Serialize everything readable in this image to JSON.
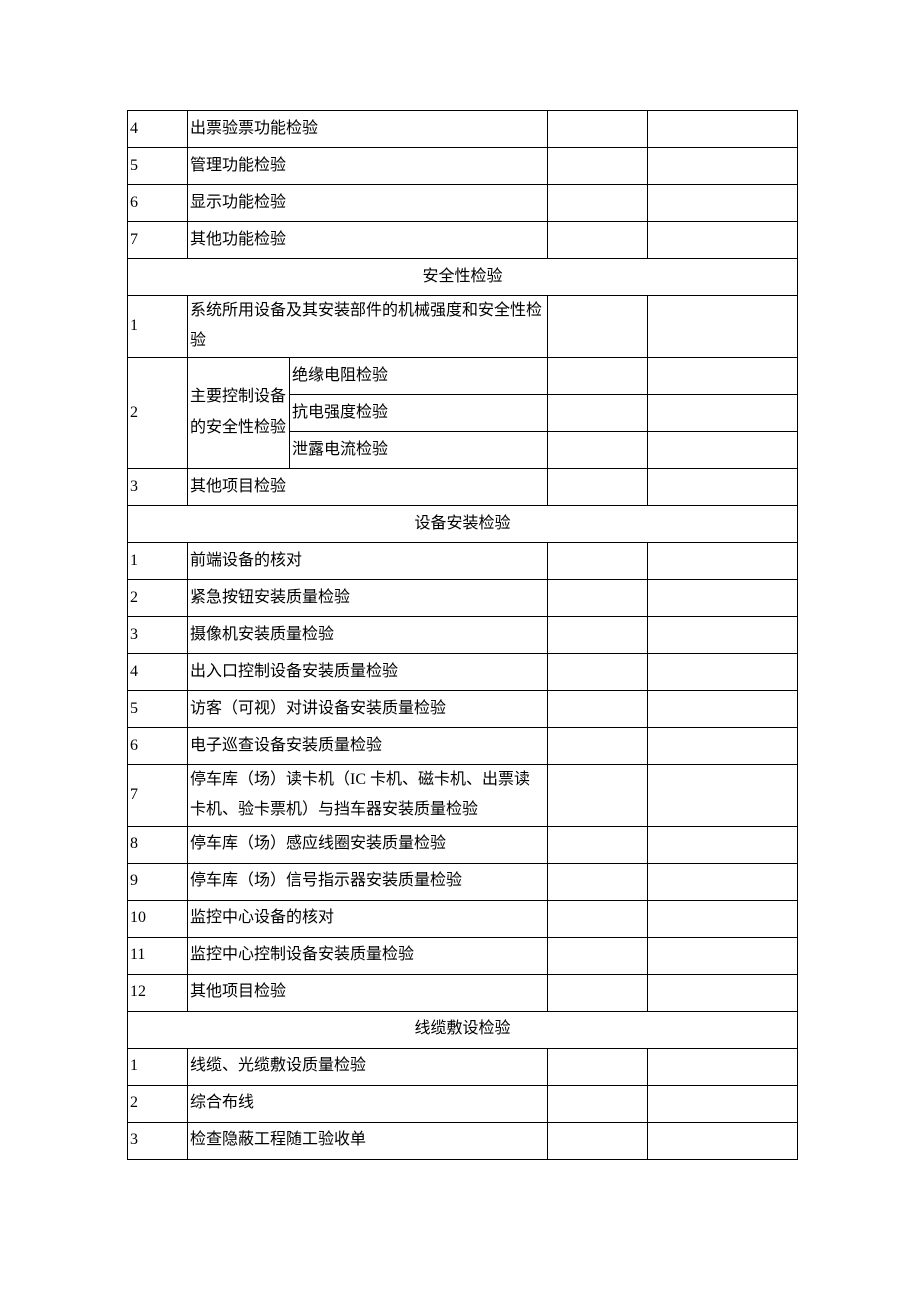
{
  "rows_top": [
    {
      "n": "4",
      "t": "出票验票功能检验"
    },
    {
      "n": "5",
      "t": "管理功能检验"
    },
    {
      "n": "6",
      "t": "显示功能检验"
    },
    {
      "n": "7",
      "t": "其他功能检验"
    }
  ],
  "section_safety": "安全性检验",
  "safety_row1": {
    "n": "1",
    "t": "系统所用设备及其安装部件的机械强度和安全性检验"
  },
  "safety_row2": {
    "n": "2",
    "left": "主要控制设备的安全性检验",
    "subs": [
      "绝缘电阻检验",
      "抗电强度检验",
      "泄露电流检验"
    ]
  },
  "safety_row3": {
    "n": "3",
    "t": "其他项目检验"
  },
  "section_install": "设备安装检验",
  "install_rows": [
    {
      "n": "1",
      "t": "前端设备的核对"
    },
    {
      "n": "2",
      "t": "紧急按钮安装质量检验"
    },
    {
      "n": "3",
      "t": "摄像机安装质量检验"
    },
    {
      "n": "4",
      "t": "出入口控制设备安装质量检验"
    },
    {
      "n": "5",
      "t": "访客（可视）对讲设备安装质量检验"
    },
    {
      "n": "6",
      "t": "电子巡查设备安装质量检验"
    },
    {
      "n": "7",
      "t": "停车库（场）读卡机（IC 卡机、磁卡机、出票读卡机、验卡票机）与挡车器安装质量检验",
      "tall": true
    },
    {
      "n": "8",
      "t": "停车库（场）感应线圈安装质量检验"
    },
    {
      "n": "9",
      "t": "停车库（场）信号指示器安装质量检验"
    },
    {
      "n": "10",
      "t": "监控中心设备的核对"
    },
    {
      "n": "11",
      "t": "监控中心控制设备安装质量检验"
    },
    {
      "n": "12",
      "t": "其他项目检验"
    }
  ],
  "section_cable": "线缆敷设检验",
  "cable_rows": [
    {
      "n": "1",
      "t": "线缆、光缆敷设质量检验"
    },
    {
      "n": "2",
      "t": "综合布线"
    },
    {
      "n": "3",
      "t": "检查隐蔽工程随工验收单"
    }
  ]
}
